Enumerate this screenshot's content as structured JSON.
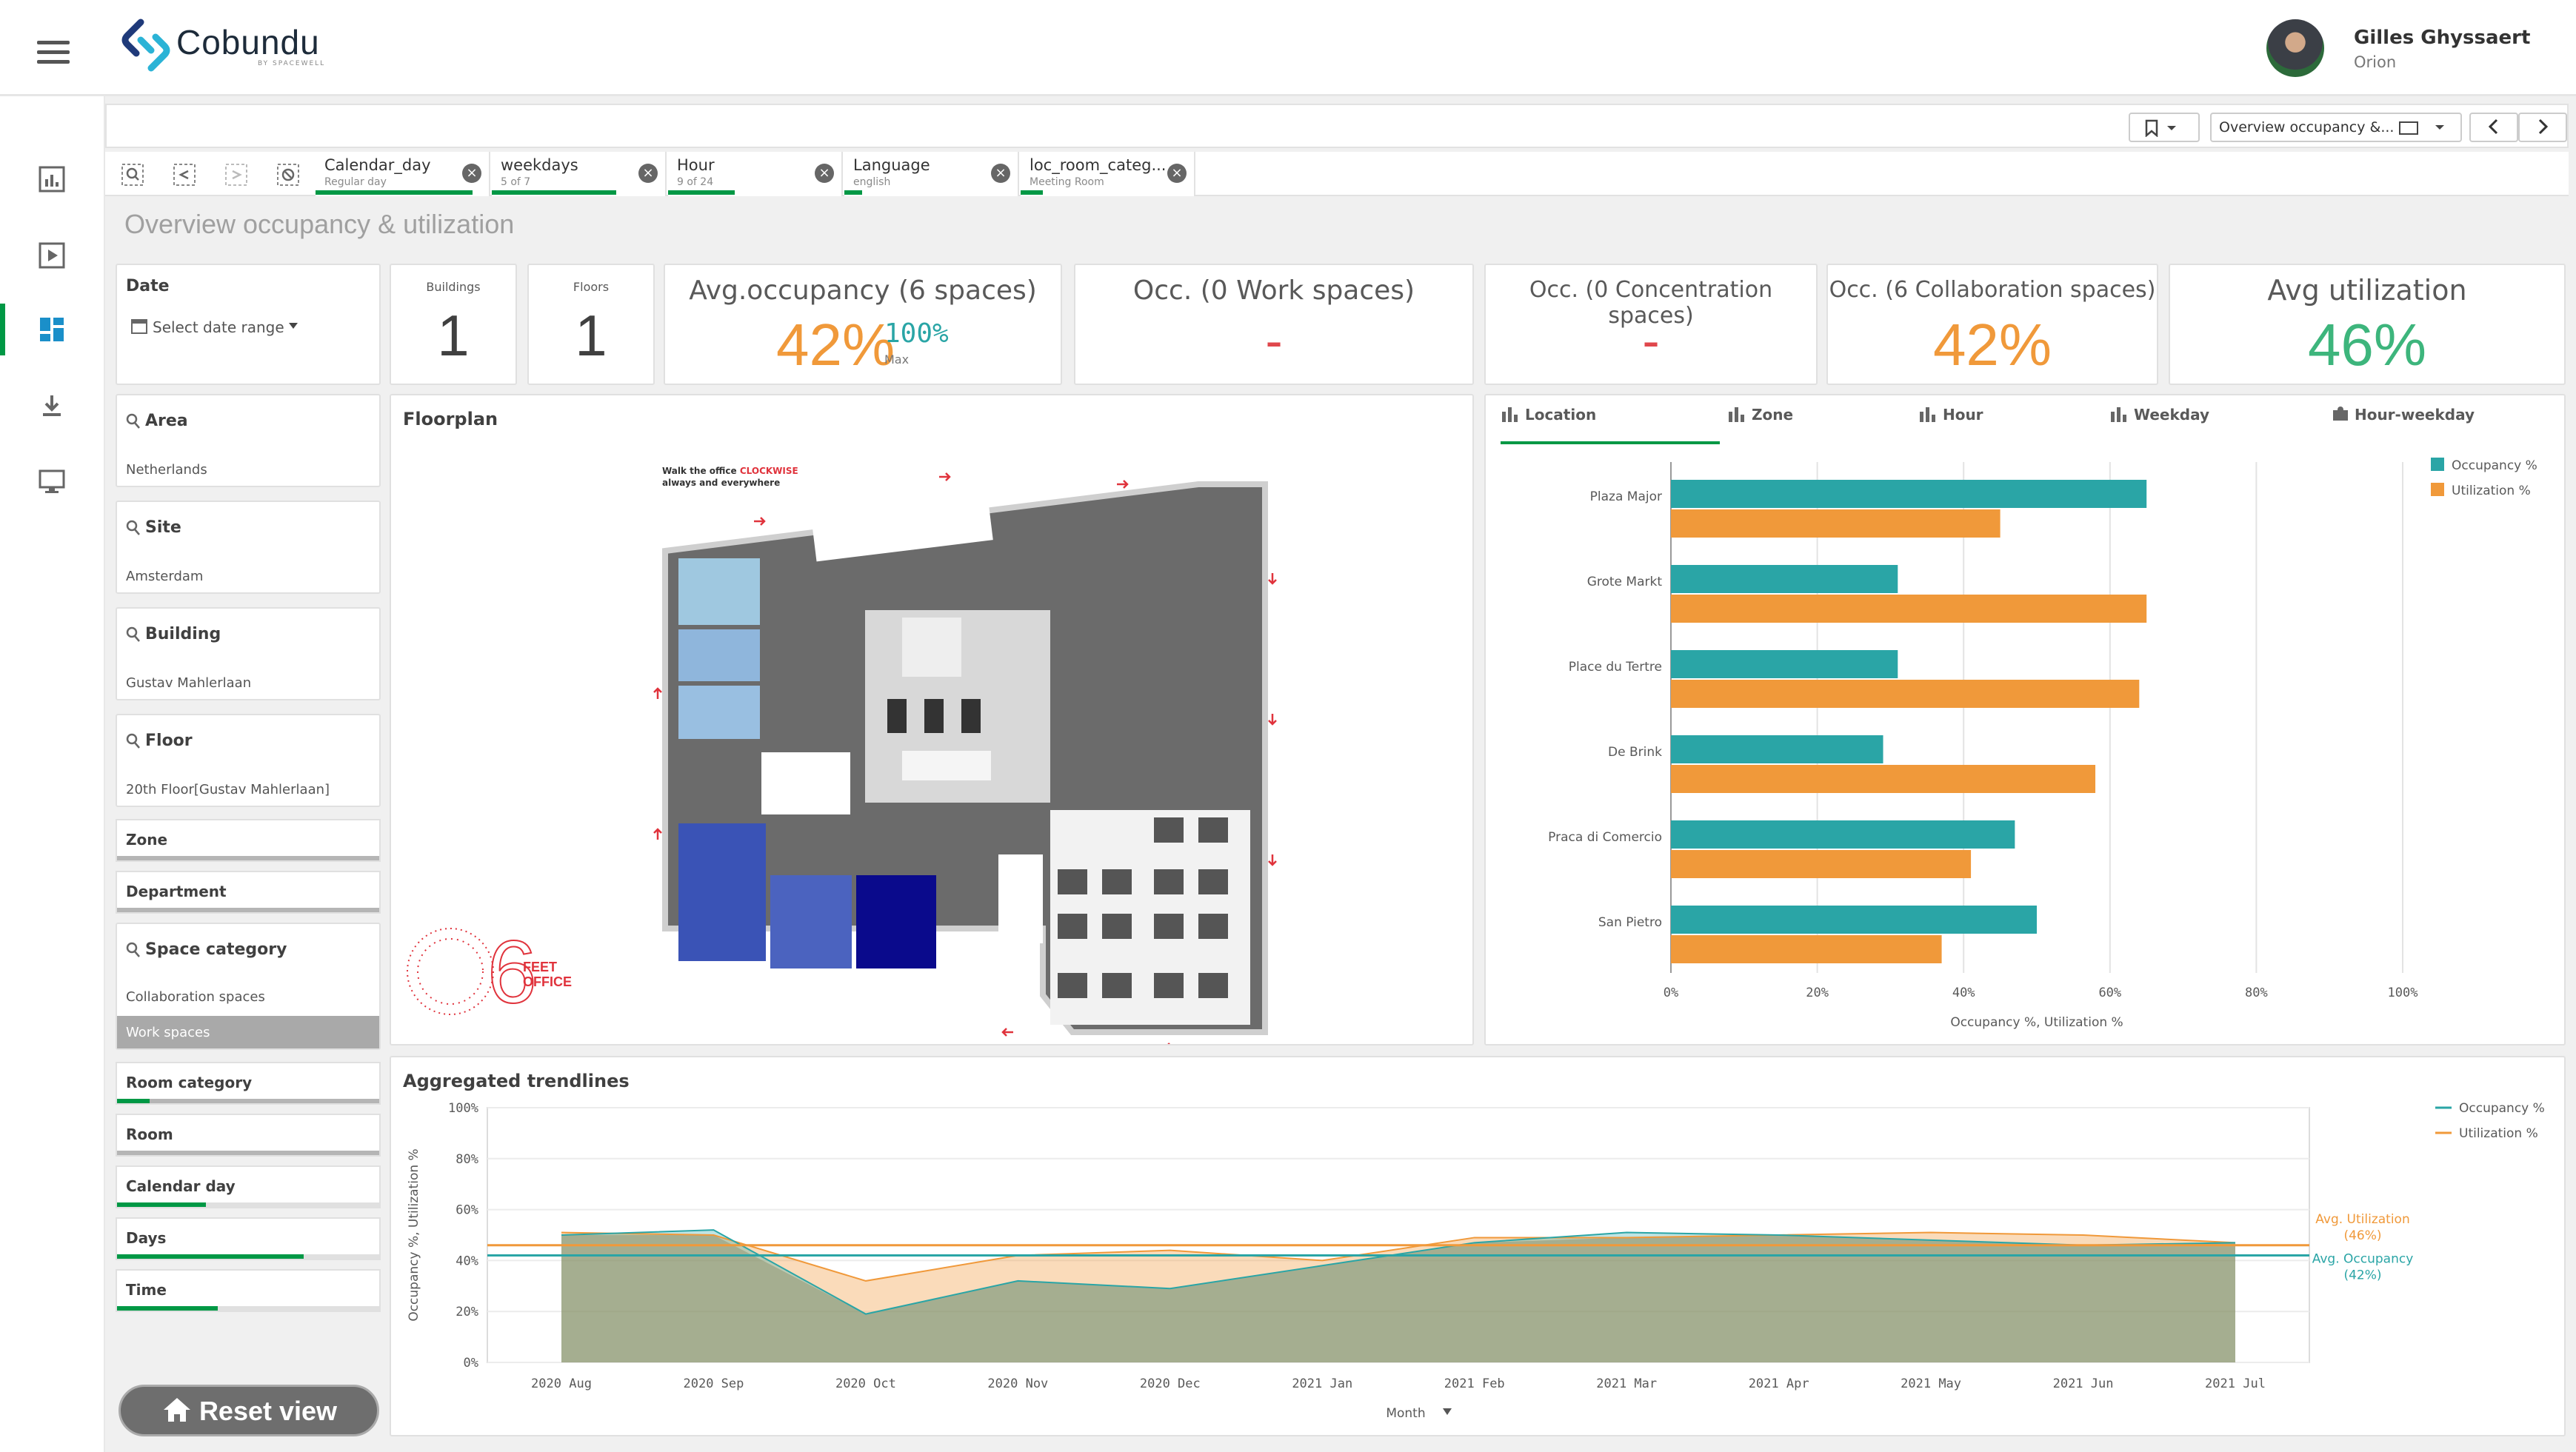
{
  "app": {
    "name": "Cobundu",
    "sub": "BY SPACEWELL"
  },
  "user": {
    "name": "Gilles Ghyssaert",
    "org": "Orion"
  },
  "toolbar": {
    "sheet_selector": "Overview occupancy &..."
  },
  "selections": [
    {
      "field": "Calendar_day",
      "value": "Regular day"
    },
    {
      "field": "weekdays",
      "value": "5 of 7"
    },
    {
      "field": "Hour",
      "value": "9 of 24"
    },
    {
      "field": "Language",
      "value": "english"
    },
    {
      "field": "loc_room_categ...",
      "value": "Meeting Room"
    }
  ],
  "sheet_title": "Overview occupancy & utilization",
  "date_filter": {
    "title": "Date",
    "placeholder": "Select date range"
  },
  "kpis": {
    "buildings": {
      "label": "Buildings",
      "value": "1"
    },
    "floors": {
      "label": "Floors",
      "value": "1"
    },
    "avg_occupancy": {
      "label": "Avg.occupancy (6 spaces)",
      "value": "42%",
      "max_value": "100%",
      "max_label": "Max"
    },
    "occ_work": {
      "label": "Occ. (0 Work spaces)",
      "value": "-"
    },
    "occ_concentration": {
      "label": "Occ. (0 Concentration spaces)",
      "value": "-"
    },
    "occ_collaboration": {
      "label": "Occ. (6 Collaboration spaces)",
      "value": "42%"
    },
    "avg_utilization": {
      "label": "Avg utilization",
      "value": "46%"
    }
  },
  "filters": [
    {
      "title": "Area",
      "value": "Netherlands"
    },
    {
      "title": "Site",
      "value": "Amsterdam"
    },
    {
      "title": "Building",
      "value": "Gustav Mahlerlaan"
    },
    {
      "title": "Floor",
      "value": "20th Floor[Gustav Mahlerlaan]"
    }
  ],
  "slim_filters": {
    "zone": "Zone",
    "department": "Department",
    "room_category": "Room category",
    "room": "Room",
    "calendar_day": "Calendar day",
    "days": "Days",
    "time": "Time"
  },
  "space_category": {
    "title": "Space category",
    "options": [
      "Collaboration spaces",
      "Work spaces"
    ]
  },
  "floorplan": {
    "title": "Floorplan",
    "note_line1": "Walk the office ",
    "note_highlight": "CLOCKWISE",
    "note_line2": "always and everywhere",
    "badge_number": "6",
    "badge_text1": "FEET",
    "badge_text2": "OFFICE"
  },
  "bar_tabs": [
    "Location",
    "Zone",
    "Hour",
    "Weekday",
    "Hour-weekday"
  ],
  "trend_title": "Aggregated trendlines",
  "reset_label": "Reset view",
  "colors": {
    "teal": "#2aa5a6",
    "orange": "#f0993a",
    "green": "#009845",
    "kpi_orange": "#f0993a",
    "kpi_green": "#3db57c",
    "red": "#e0474c"
  },
  "chart_data": [
    {
      "type": "bar",
      "orientation": "horizontal",
      "categories": [
        "Plaza Major",
        "Grote Markt",
        "Place du Tertre",
        "De Brink",
        "Praca di Comercio",
        "San Pietro"
      ],
      "series": [
        {
          "name": "Occupancy %",
          "values": [
            65,
            31,
            31,
            29,
            47,
            50
          ]
        },
        {
          "name": "Utilization %",
          "values": [
            45,
            65,
            64,
            58,
            41,
            37
          ]
        }
      ],
      "xlabel": "Occupancy %, Utilization %",
      "xlim": [
        0,
        100
      ],
      "xticks": [
        "0%",
        "20%",
        "40%",
        "60%",
        "80%",
        "100%"
      ],
      "legend": "top-right",
      "grid": true
    },
    {
      "type": "area",
      "categories": [
        "2020 Aug",
        "2020 Sep",
        "2020 Oct",
        "2020 Nov",
        "2020 Dec",
        "2021 Jan",
        "2021 Feb",
        "2021 Mar",
        "2021 Apr",
        "2021 May",
        "2021 Jun",
        "2021 Jul"
      ],
      "series": [
        {
          "name": "Occupancy %",
          "values": [
            50,
            52,
            19,
            32,
            29,
            38,
            47,
            51,
            50,
            48,
            46,
            47
          ]
        },
        {
          "name": "Utilization %",
          "values": [
            51,
            50,
            32,
            42,
            44,
            40,
            49,
            49,
            50,
            51,
            50,
            47
          ]
        }
      ],
      "reference_lines": [
        {
          "label": "Avg. Utilization",
          "value_label": "(46%)",
          "value": 46
        },
        {
          "label": "Avg. Occupancy",
          "value_label": "(42%)",
          "value": 42
        }
      ],
      "xlabel": "Month",
      "ylabel": "Occupancy %, Utilization %",
      "ylim": [
        0,
        100
      ],
      "yticks": [
        "0%",
        "20%",
        "40%",
        "60%",
        "80%",
        "100%"
      ],
      "legend": "top-right"
    }
  ]
}
